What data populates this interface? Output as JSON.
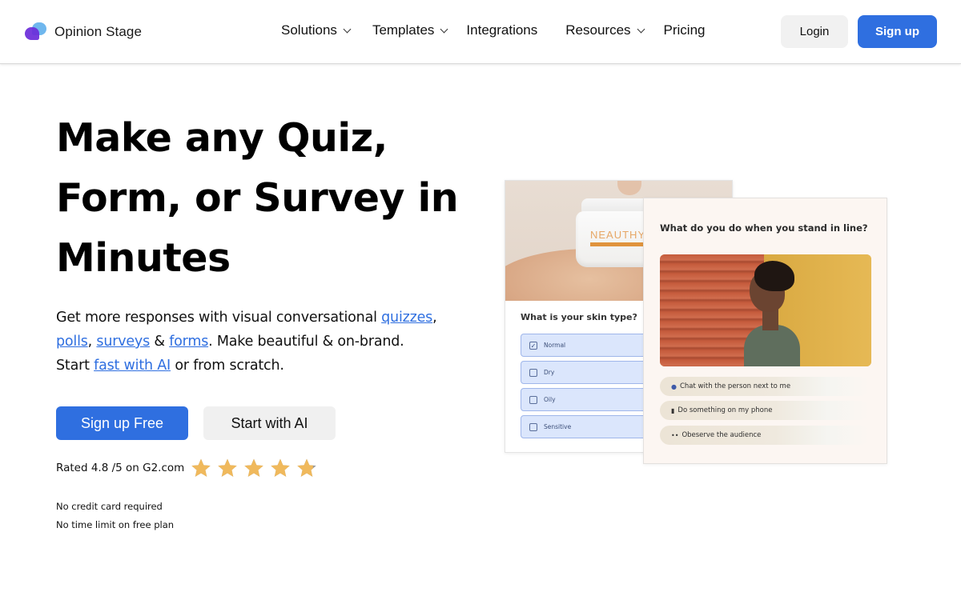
{
  "header": {
    "brand": "Opinion Stage",
    "nav": [
      {
        "label": "Solutions",
        "has_dropdown": true
      },
      {
        "label": "Templates",
        "has_dropdown": true
      },
      {
        "label": "Integrations",
        "has_dropdown": false
      },
      {
        "label": "Resources",
        "has_dropdown": true
      },
      {
        "label": "Pricing",
        "has_dropdown": false
      }
    ],
    "login_label": "Login",
    "signup_label": "Sign up"
  },
  "hero": {
    "title_lines": [
      "Make any Quiz,",
      "Form, or Survey in",
      "Minutes"
    ],
    "subtitle": {
      "part1": "Get more responses with visual conversational ",
      "link_quizzes": "quizzes",
      "sep1": ", ",
      "link_polls": "polls",
      "sep2": ", ",
      "link_surveys": "surveys",
      "sep3": " & ",
      "link_forms": "forms",
      "part2": ". Make beautiful & on-brand. Start ",
      "link_ai": "fast with AI",
      "part3": " or from scratch."
    },
    "cta_primary": "Sign up Free",
    "cta_secondary": "Start with AI",
    "rating": {
      "text": "Rated 4.8 /5 on G2.com",
      "value": 4.8,
      "max": 5
    },
    "notes": [
      "No credit card required",
      "No time limit on free plan"
    ]
  },
  "preview_cards": {
    "skin": {
      "brand_on_jar": "NEAUTHY",
      "question": "What is your skin type?",
      "options": [
        {
          "label": "Normal",
          "checked": true
        },
        {
          "label": "Dry",
          "checked": false
        },
        {
          "label": "Oily",
          "checked": false
        },
        {
          "label": "Sensitive",
          "checked": false
        }
      ]
    },
    "line": {
      "question": "What do you do when you stand in line?",
      "options": [
        {
          "icon": "speech-bubble-icon",
          "glyph": "●",
          "label": "Chat with the person next to me"
        },
        {
          "icon": "phone-icon",
          "glyph": "▮",
          "label": "Do something on my phone"
        },
        {
          "icon": "eyes-icon",
          "glyph": "••",
          "label": "Obeserve the audience"
        }
      ]
    }
  },
  "colors": {
    "accent": "#2f6fe0",
    "star": "#f0b95c",
    "skin_option_bg": "#dbe6fc",
    "line_card_bg": "#fcf6f2"
  }
}
